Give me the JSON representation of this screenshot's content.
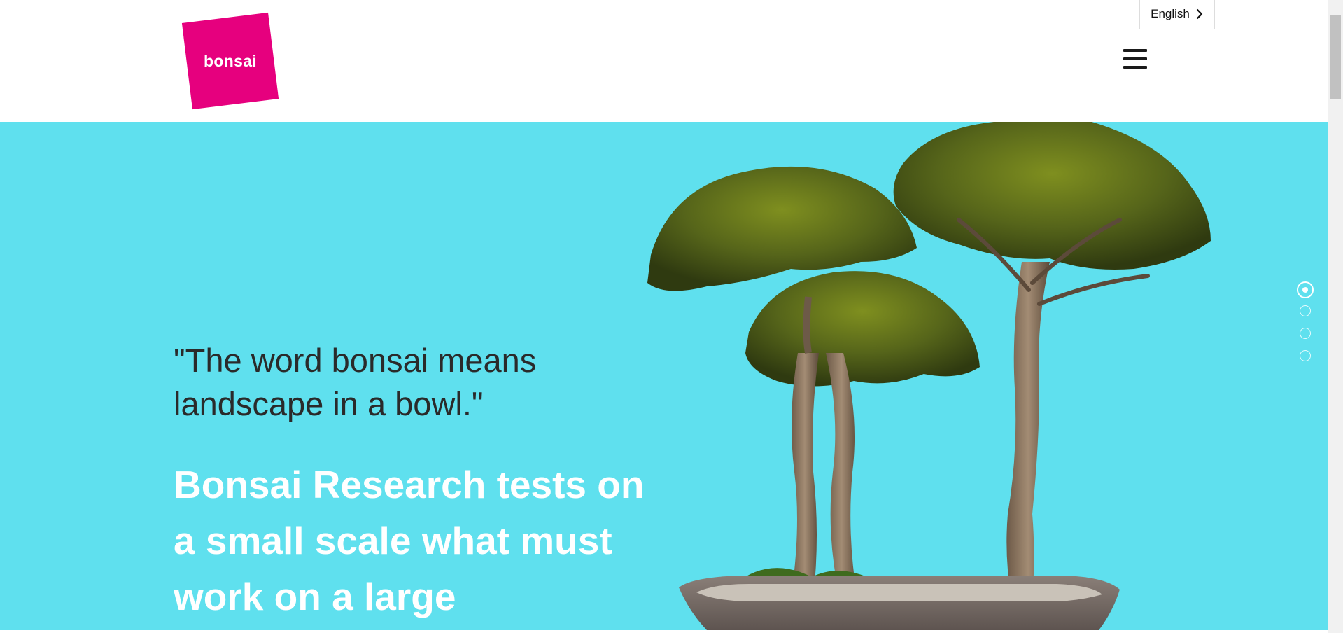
{
  "header": {
    "logo_text": "bonsai",
    "language_label": "English",
    "language_icon": "chevron-right-icon",
    "menu_icon": "hamburger-menu-icon"
  },
  "hero": {
    "quote": " \"The word bonsai means\nlandscape in a bowl.\"",
    "headline": "Bonsai Research tests on a small scale what must work on a large",
    "image": "bonsai-trees-in-pot"
  },
  "slider": {
    "count": 4,
    "active_index": 0
  },
  "colors": {
    "brand_pink": "#e6007e",
    "hero_background": "#5fe0ee",
    "headline_text": "#ffffff",
    "quote_text": "#2a2a2a"
  }
}
